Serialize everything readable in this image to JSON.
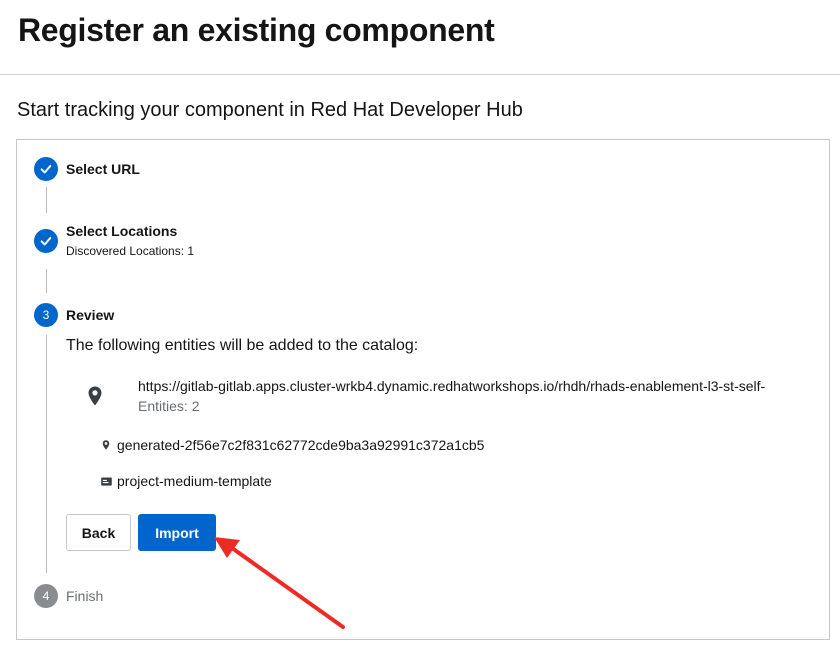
{
  "header": {
    "title": "Register an existing component"
  },
  "subtitle": "Start tracking your component in Red Hat Developer Hub",
  "steps": [
    {
      "title": "Select URL",
      "status": "complete"
    },
    {
      "title": "Select Locations",
      "subtitle": "Discovered Locations: 1",
      "status": "complete"
    },
    {
      "number": "3",
      "title": "Review",
      "status": "active"
    },
    {
      "number": "4",
      "title": "Finish",
      "status": "pending"
    }
  ],
  "review": {
    "intro": "The following entities will be added to the catalog:",
    "location": {
      "url": "https://gitlab-gitlab.apps.cluster-wrkb4.dynamic.redhatworkshops.io/rhdh/rhads-enablement-l3-st-self-",
      "entities_count": "Entities: 2",
      "icon": "location-pin-icon"
    },
    "entities": [
      {
        "label": "generated-2f56e7c2f831c62772cde9ba3a92991c372a1cb5",
        "icon": "location-pin-icon"
      },
      {
        "label": "project-medium-template",
        "icon": "template-icon"
      }
    ]
  },
  "buttons": {
    "back": "Back",
    "import": "Import"
  },
  "colors": {
    "primary": "#0066cc",
    "pending": "#8a8d90",
    "annotation_arrow": "#ee2a24"
  }
}
